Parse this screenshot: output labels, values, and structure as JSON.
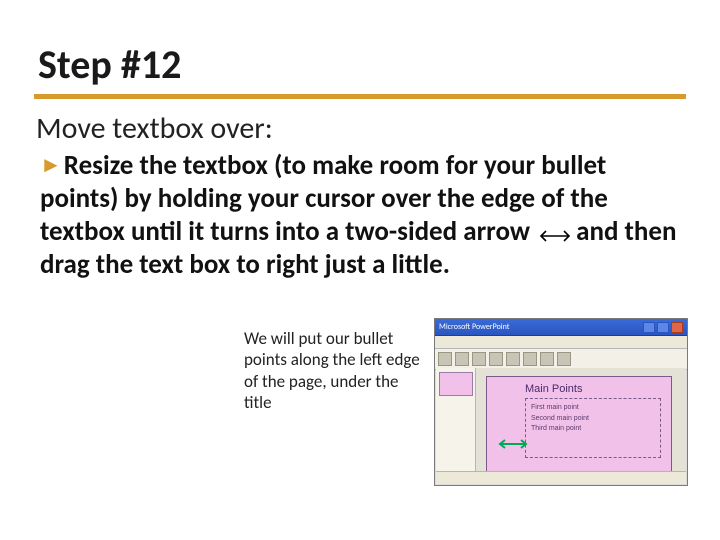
{
  "title": "Step #12",
  "subtitle": "Move textbox over:",
  "bullet_marker": "►",
  "body_before": "Resize the textbox (to make room for your bullet points) by holding your cursor over the edge of the textbox until it turns into a two-sided arrow",
  "body_after": "and then drag the text box to right just a little.",
  "caption": "We will put our bullet points along the left edge of the page, under the title",
  "thumb": {
    "app_title": "Microsoft PowerPoint",
    "slide_title": "Main Points",
    "points": [
      "First main point",
      "Second main point",
      "Third main point"
    ]
  },
  "colors": {
    "accent": "#d69a2d",
    "slide_bg": "#f2c1ea"
  }
}
